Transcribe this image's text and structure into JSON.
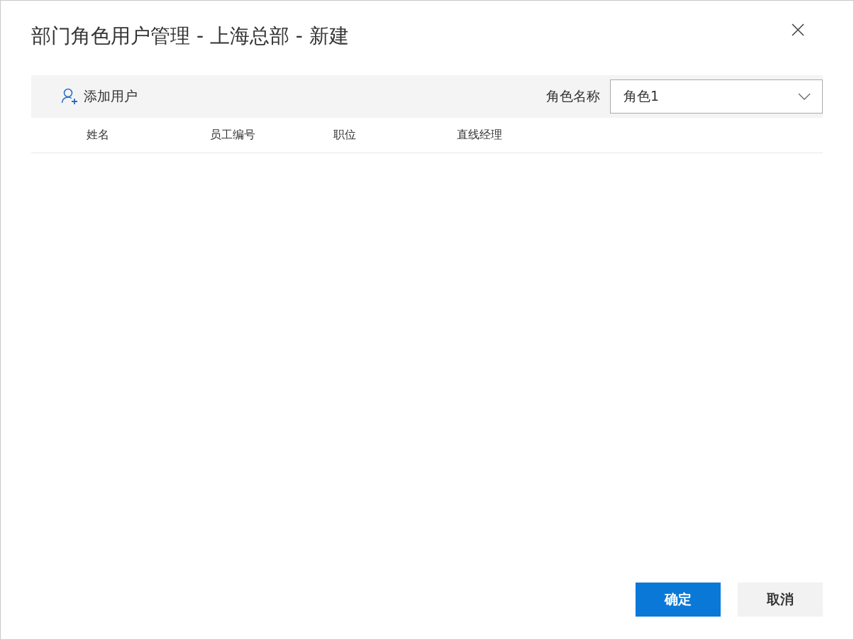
{
  "dialog": {
    "title": "部门角色用户管理 - 上海总部 - 新建"
  },
  "toolbar": {
    "add_user": "添加用户",
    "role_label": "角色名称",
    "role_value": "角色1"
  },
  "table": {
    "columns": [
      "姓名",
      "员工编号",
      "职位",
      "直线经理"
    ]
  },
  "buttons": [
    {
      "label": "确定",
      "kind": "primary"
    },
    {
      "label": "取消",
      "kind": "default"
    }
  ]
}
